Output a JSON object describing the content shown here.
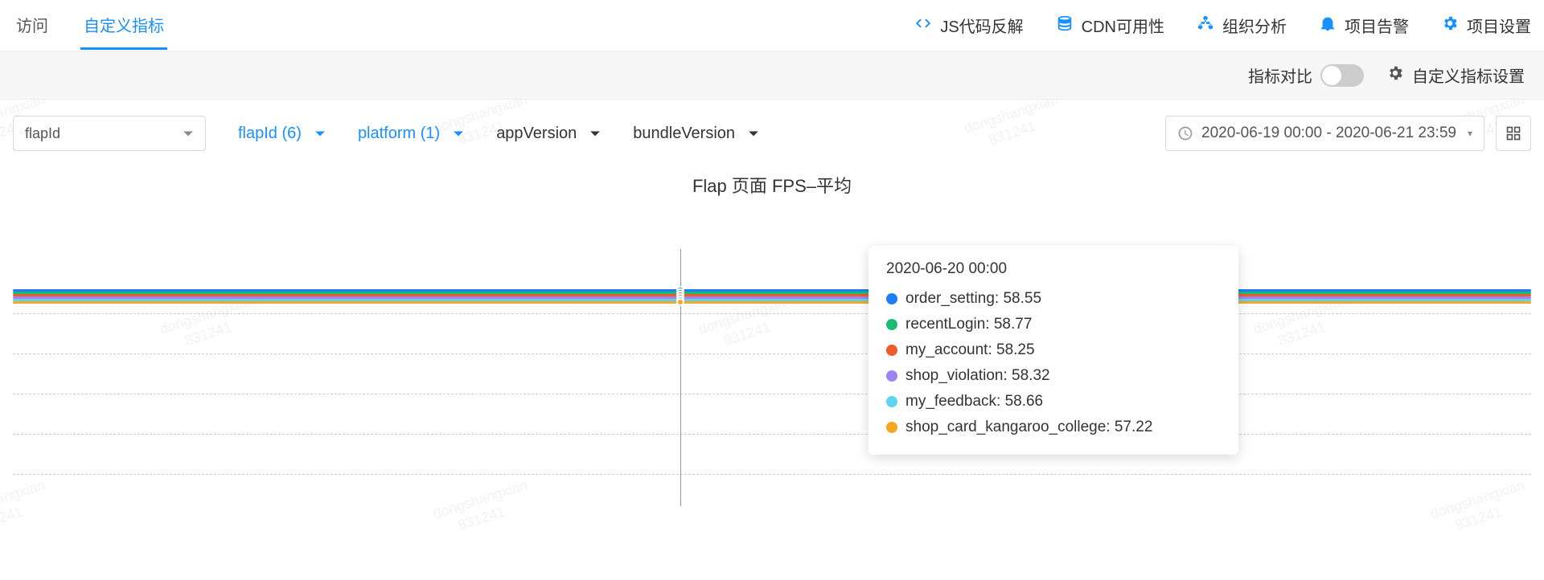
{
  "watermark": "dongshangxian\n     831241",
  "nav": {
    "tabs": [
      {
        "label": "访问",
        "active": false
      },
      {
        "label": "自定义指标",
        "active": true
      }
    ],
    "right": [
      {
        "label": "JS代码反解",
        "icon": "code-icon"
      },
      {
        "label": "CDN可用性",
        "icon": "database-icon"
      },
      {
        "label": "组织分析",
        "icon": "org-icon"
      },
      {
        "label": "项目告警",
        "icon": "bell-icon"
      },
      {
        "label": "项目设置",
        "icon": "gear-icon"
      }
    ]
  },
  "toolbar": {
    "compare_label": "指标对比",
    "settings_label": "自定义指标设置"
  },
  "filters": {
    "primary_select": "flapId",
    "pills": [
      {
        "label": "flapId (6)",
        "active": true
      },
      {
        "label": "platform (1)",
        "active": true
      },
      {
        "label": "appVersion",
        "active": false
      },
      {
        "label": "bundleVersion",
        "active": false
      }
    ],
    "date_range": "2020-06-19 00:00 - 2020-06-21 23:59"
  },
  "chart": {
    "title": "Flap 页面 FPS–平均"
  },
  "chart_data": {
    "type": "line",
    "title": "Flap 页面 FPS–平均",
    "x": [
      "2020-06-19 00:00",
      "2020-06-20 00:00",
      "2020-06-21 23:59"
    ],
    "ylim": [
      0,
      60
    ],
    "cursor_x": "2020-06-20 00:00",
    "series": [
      {
        "name": "order_setting",
        "color": "#1e7ef5",
        "value_at_cursor": 58.55
      },
      {
        "name": "recentLogin",
        "color": "#1abc74",
        "value_at_cursor": 58.77
      },
      {
        "name": "my_account",
        "color": "#f05b2b",
        "value_at_cursor": 58.25
      },
      {
        "name": "shop_violation",
        "color": "#9d84f0",
        "value_at_cursor": 58.32
      },
      {
        "name": "my_feedback",
        "color": "#5fd4ef",
        "value_at_cursor": 58.66
      },
      {
        "name": "shop_card_kangaroo_college",
        "color": "#f5a623",
        "value_at_cursor": 57.22
      }
    ]
  },
  "tooltip": {
    "title": "2020-06-20 00:00",
    "rows": [
      {
        "label": "order_setting: 58.55",
        "color": "#1e7ef5"
      },
      {
        "label": "recentLogin: 58.77",
        "color": "#1abc74"
      },
      {
        "label": "my_account: 58.25",
        "color": "#f05b2b"
      },
      {
        "label": "shop_violation: 58.32",
        "color": "#9d84f0"
      },
      {
        "label": "my_feedback: 58.66",
        "color": "#5fd4ef"
      },
      {
        "label": "shop_card_kangaroo_college: 57.22",
        "color": "#f5a623"
      }
    ]
  }
}
